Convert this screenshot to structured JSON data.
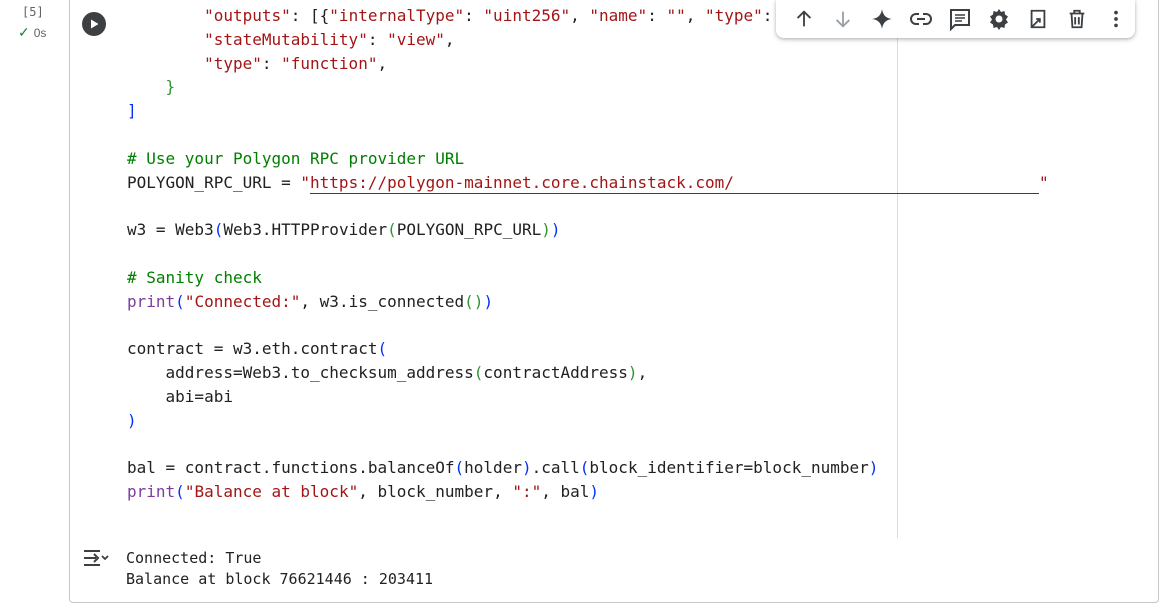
{
  "cell": {
    "execution_count": "[5]",
    "duration": "0s",
    "status_icon": "check-icon"
  },
  "toolbar": {
    "items": [
      {
        "name": "move-up",
        "icon": "arrow-up-icon"
      },
      {
        "name": "move-down",
        "icon": "arrow-down-icon"
      },
      {
        "name": "gemini",
        "icon": "sparkle-icon"
      },
      {
        "name": "link",
        "icon": "link-icon"
      },
      {
        "name": "comment",
        "icon": "comment-icon"
      },
      {
        "name": "settings",
        "icon": "gear-icon"
      },
      {
        "name": "mirror-cell",
        "icon": "mirror-icon"
      },
      {
        "name": "delete",
        "icon": "trash-icon"
      },
      {
        "name": "more",
        "icon": "more-vert-icon"
      }
    ]
  },
  "code": {
    "l1_indent": "        ",
    "l1_k1": "\"outputs\"",
    "l1_p1": ": [{",
    "l1_k2": "\"internalType\"",
    "l1_p2": ": ",
    "l1_v2": "\"uint256\"",
    "l1_p3": ", ",
    "l1_k3": "\"name\"",
    "l1_p4": ": ",
    "l1_v3": "\"\"",
    "l1_p5": ", ",
    "l1_k4": "\"type\"",
    "l1_p6": ":",
    "l2_indent": "        ",
    "l2_k": "\"stateMutability\"",
    "l2_p": ": ",
    "l2_v": "\"view\"",
    "l2_end": ",",
    "l3_indent": "        ",
    "l3_k": "\"type\"",
    "l3_p": ": ",
    "l3_v": "\"function\"",
    "l3_end": ",",
    "l4_indent": "    ",
    "l4_brace": "}",
    "l5_bracket": "]",
    "comment1": "# Use your Polygon RPC provider URL",
    "rpc_var": "POLYGON_RPC_URL = ",
    "rpc_quote_open": "\"",
    "rpc_url": "https://polygon-mainnet.core.chainstack.com/",
    "rpc_quote_close": "\"",
    "w3_a": "w3 = Web3",
    "w3_p1": "(",
    "w3_b": "Web3.HTTPProvider",
    "w3_p2": "(",
    "w3_c": "POLYGON_RPC_URL",
    "w3_p3": ")",
    "w3_p4": ")",
    "comment2": "# Sanity check",
    "print1_fn": "print",
    "print1_p1": "(",
    "print1_s": "\"Connected:\"",
    "print1_mid": ", w3.is_connected",
    "print1_p2": "()",
    "print1_p3": ")",
    "contract_a": "contract = w3.eth.contract",
    "contract_p": "(",
    "addr_indent": "    ",
    "addr_a": "address=Web3.to_checksum_address",
    "addr_p1": "(",
    "addr_b": "contractAddress",
    "addr_p2": ")",
    "addr_end": ",",
    "abi_indent": "    ",
    "abi_line": "abi=abi",
    "contract_close": ")",
    "bal_a": "bal = contract.functions.balanceOf",
    "bal_p1": "(",
    "bal_b": "holder",
    "bal_p2": ")",
    "bal_c": ".call",
    "bal_p3": "(",
    "bal_d": "block_identifier=block_number",
    "bal_p4": ")",
    "print2_fn": "print",
    "print2_p1": "(",
    "print2_s1": "\"Balance at block\"",
    "print2_mid": ", block_number, ",
    "print2_s2": "\":\"",
    "print2_end": ", bal",
    "print2_p2": ")"
  },
  "output": {
    "icon": "output-toggle-icon",
    "lines": [
      "Connected: True",
      "Balance at block 76621446 : 203411"
    ]
  },
  "colors": {
    "string": "#a31515",
    "comment": "#008000",
    "bracket_level1": "#0431fa",
    "bracket_level2": "#319331",
    "bracket_level3": "#7b3814",
    "keyword_print": "#7a3e9d",
    "check": "#188038"
  }
}
